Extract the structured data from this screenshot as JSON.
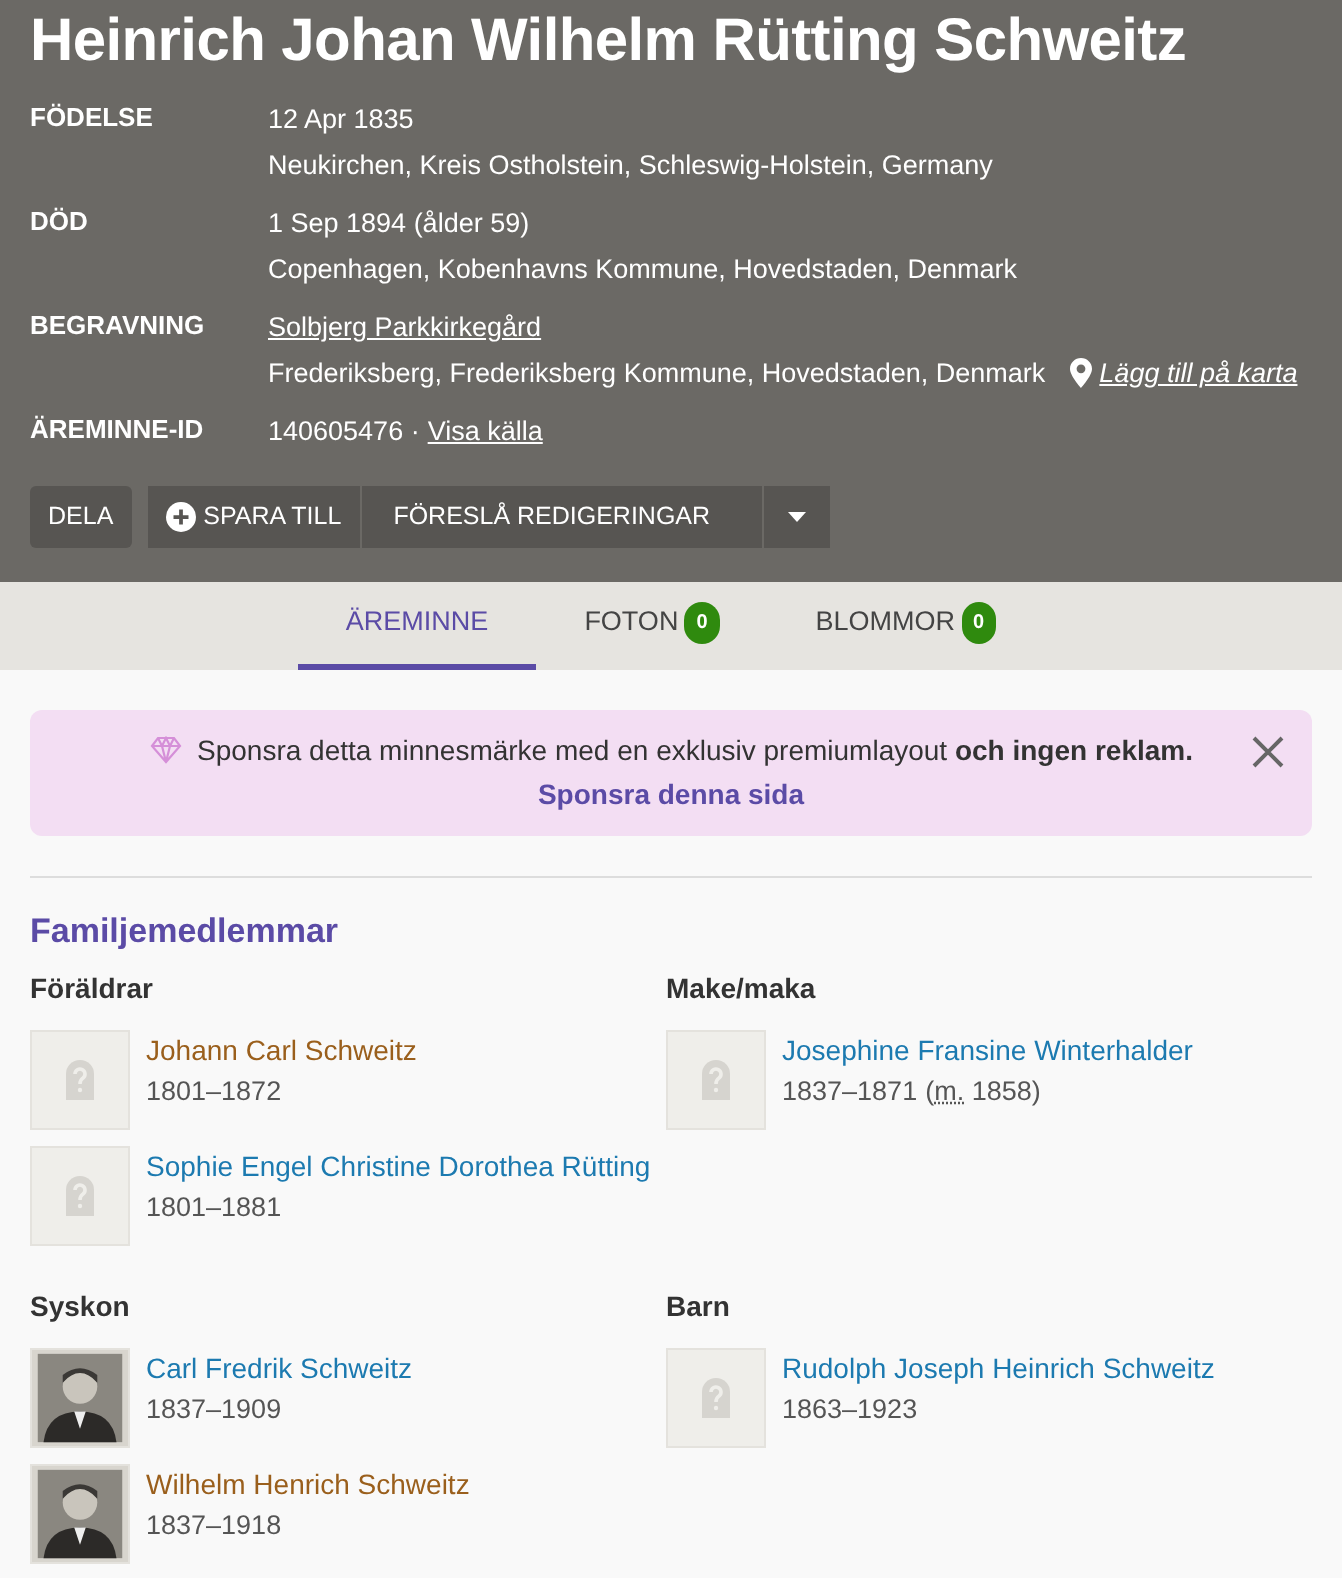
{
  "title": "Heinrich Johan Wilhelm Rütting Schweitz",
  "facts": [
    {
      "label": "FÖDELSE",
      "lines": [
        {
          "text": "12 Apr 1835"
        },
        {
          "text": "Neukirchen, Kreis Ostholstein, Schleswig-Holstein, Germany"
        }
      ]
    },
    {
      "label": "DÖD",
      "lines": [
        {
          "text": "1 Sep 1894 (ålder 59)"
        },
        {
          "text": "Copenhagen, Kobenhavns Kommune, Hovedstaden, Denmark"
        }
      ]
    },
    {
      "label": "BEGRAVNING",
      "lines": [
        {
          "link": "Solbjerg Parkkirkegård"
        },
        {
          "text": "Frederiksberg, Frederiksberg Kommune, Hovedstaden, Denmark",
          "map_link": "Lägg till på karta"
        }
      ]
    },
    {
      "label": "ÄREMINNE-ID",
      "lines": [
        {
          "text": "140605476 ·",
          "link": "Visa källa"
        }
      ]
    }
  ],
  "actions": {
    "share": "DELA",
    "save": "SPARA TILL",
    "suggest": "FÖRESLÅ REDIGERINGAR"
  },
  "tabs": [
    {
      "label": "ÄREMINNE",
      "selected": true
    },
    {
      "label": "FOTON",
      "count": "0",
      "selected": false
    },
    {
      "label": "BLOMMOR",
      "count": "0",
      "selected": false
    }
  ],
  "sponsor": {
    "message": "Sponsra detta minnesmärke med en exklusiv premiumlayout **och ingen reklam.**",
    "link": "Sponsra denna sida"
  },
  "family": {
    "title": "Familjemedlemmar",
    "groups": [
      {
        "title": "Föräldrar",
        "members": [
          {
            "name": "Johann Carl Schweitz",
            "years": "1801–1872",
            "color": "#9a5f1c",
            "kind": "placeholder"
          },
          {
            "name": "Sophie Engel Christine Dorothea Rütting",
            "years": "1801–1881",
            "color": "#1c7ab0",
            "kind": "placeholder"
          }
        ]
      },
      {
        "title": "Make/maka",
        "members": [
          {
            "name": "Josephine Fransine Winterhalder",
            "years": "1837–1871",
            "marriage_open": "(",
            "marriage_abbr": "m.",
            "marriage_year": "1858)",
            "color": "#1c7ab0",
            "kind": "placeholder"
          }
        ]
      },
      {
        "title": "Syskon",
        "members": [
          {
            "name": "Carl Fredrik Schweitz",
            "years": "1837–1909",
            "color": "#1c7ab0"
          },
          {
            "name": "Wilhelm Henrich Schweitz",
            "years": "1837–1918",
            "color": "#9a5f1c"
          }
        ]
      },
      {
        "title": "Barn",
        "members": [
          {
            "name": "Rudolph Joseph Heinrich Schweitz",
            "years": "1863–1923",
            "color": "#1c7ab0",
            "kind": "placeholder"
          }
        ]
      }
    ]
  }
}
